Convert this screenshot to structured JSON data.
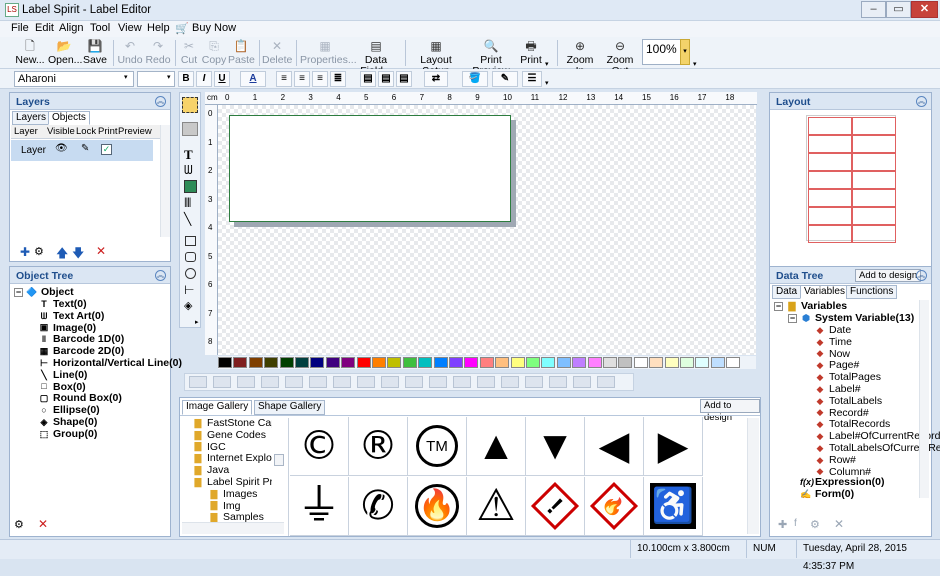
{
  "window": {
    "title": "Label Spirit - Label Editor",
    "controls": [
      "–",
      "▭",
      "✕"
    ]
  },
  "menu": [
    "File",
    "Edit",
    "Align",
    "Tool",
    "View",
    "Help",
    "Buy Now"
  ],
  "toolbar": {
    "new": "New...",
    "open": "Open...",
    "save": "Save",
    "undo": "Undo",
    "redo": "Redo",
    "cut": "Cut",
    "copy": "Copy",
    "paste": "Paste",
    "delete": "Delete",
    "properties": "Properties...",
    "data_field": "Data Field...",
    "layout_setup": "Layout Setup",
    "print_preview": "Print Preview",
    "print": "Print",
    "zoom_in": "Zoom In",
    "zoom_out": "Zoom Out",
    "zoom_value": "100%"
  },
  "format_toolbar": {
    "font_name": "Aharoni",
    "bold": "B",
    "italic": "I",
    "underline": "U",
    "font_color": "A"
  },
  "layers_panel": {
    "title": "Layers",
    "tabs": [
      "Layers",
      "Objects"
    ],
    "columns": [
      "Layer",
      "Visible",
      "Lock",
      "Print",
      "Preview"
    ],
    "row": {
      "name": "Layer"
    }
  },
  "object_tree": {
    "title": "Object Tree",
    "root": "Object",
    "items": [
      "Text(0)",
      "Text Art(0)",
      "Image(0)",
      "Barcode 1D(0)",
      "Barcode 2D(0)",
      "Horizontal/Vertical Line(0)",
      "Line(0)",
      "Box(0)",
      "Round Box(0)",
      "Ellipse(0)",
      "Shape(0)",
      "Group(0)"
    ],
    "icons": [
      "text-icon",
      "text-art-icon",
      "image-icon",
      "barcode-1d-icon",
      "barcode-2d-icon",
      "hv-line-icon",
      "line-icon",
      "box-icon",
      "round-box-icon",
      "ellipse-icon",
      "shape-icon",
      "group-icon"
    ]
  },
  "ruler": {
    "unit": "cm",
    "top_ticks": [
      "0",
      "1",
      "2",
      "3",
      "4",
      "5",
      "6",
      "7",
      "8",
      "9",
      "10",
      "11",
      "12",
      "13",
      "14",
      "15",
      "16",
      "17",
      "18"
    ],
    "left_ticks": [
      "0",
      "1",
      "2",
      "3",
      "4",
      "5",
      "6",
      "7",
      "8"
    ]
  },
  "palette": [
    "#000000",
    "#7f1f1f",
    "#7f3f00",
    "#3f3f00",
    "#003f00",
    "#003f3f",
    "#00007f",
    "#3f007f",
    "#7f007f",
    "#ff0000",
    "#ff7f00",
    "#bfbf00",
    "#3fbf3f",
    "#00bfbf",
    "#007fff",
    "#7f3fff",
    "#ff00ff",
    "#ff7f7f",
    "#ffbf7f",
    "#ffff7f",
    "#7fff7f",
    "#7fffff",
    "#7fbfff",
    "#bf7fff",
    "#ff7fff",
    "#dfdfdf",
    "#c0c0c0",
    "#ffffff",
    "#ffdfbf",
    "#ffffbf",
    "#dfffdf",
    "#dfffff",
    "#bfdfff",
    "#ffffff"
  ],
  "gallery": {
    "tabs": [
      "Image Gallery",
      "Shape Gallery"
    ],
    "add_button": "Add to design",
    "folders": [
      "FastStone Cap",
      "Gene Codes",
      "IGC",
      "Internet Explor",
      "Java",
      "Label Spirit Pro",
      "Images",
      "Img",
      "Samples"
    ],
    "symbols_row1": [
      "©",
      "®",
      "™",
      "up-arrow",
      "down-arrow",
      "left-arrow",
      "right-arrow"
    ],
    "symbols_row2": [
      "ground",
      "phone",
      "flammable",
      "oxidizer",
      "exclamation",
      "flammable-diamond",
      "wheelchair"
    ]
  },
  "layout_panel": {
    "title": "Layout"
  },
  "data_tree": {
    "title": "Data Tree",
    "add_button": "Add to design",
    "tabs": [
      "Data",
      "Variables",
      "Functions"
    ],
    "root": "Variables",
    "group": "System Variable(13)",
    "items": [
      "Date",
      "Time",
      "Now",
      "Page#",
      "TotalPages",
      "Label#",
      "TotalLabels",
      "Record#",
      "TotalRecords",
      "Label#OfCurrentRecord",
      "TotalLabelsOfCurrentRe",
      "Row#",
      "Column#"
    ],
    "expression": "Expression(0)",
    "form": "Form(0)"
  },
  "status": {
    "size": "10.100cm x 3.800cm",
    "num": "NUM",
    "datetime": "Tuesday, April 28, 2015 4:35:37 PM"
  }
}
